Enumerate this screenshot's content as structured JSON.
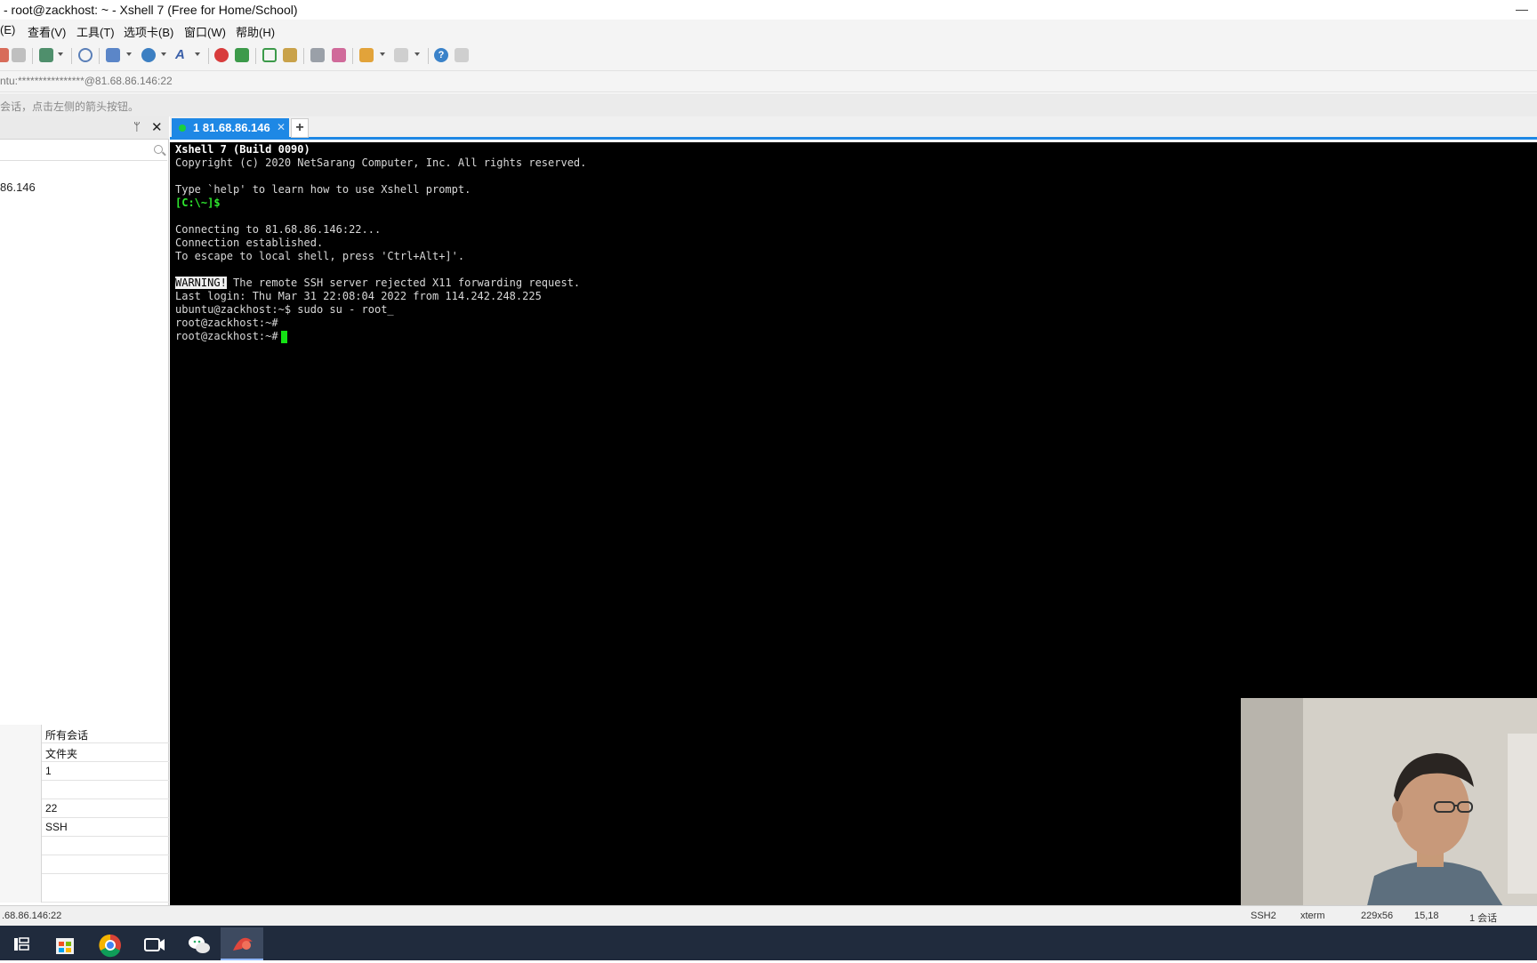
{
  "window": {
    "title": "- root@zackhost: ~ - Xshell 7 (Free for Home/School)",
    "minimize": "—"
  },
  "menu": [
    "(E)",
    "查看(V)",
    "工具(T)",
    "选项卡(B)",
    "窗口(W)",
    "帮助(H)"
  ],
  "address_bar": {
    "text": "ntu:****************@81.68.86.146:22"
  },
  "hint_bar": {
    "text": "会话，点击左侧的箭头按钮。"
  },
  "sidebar": {
    "pin": "ᛘ",
    "close": "✕",
    "session": "86.146",
    "properties": [
      "所有会话",
      "文件夹",
      "1",
      "",
      "22",
      "SSH",
      "",
      "",
      ""
    ]
  },
  "tabs": [
    {
      "label": "1 81.68.86.146",
      "status_color": "#1bcf3c"
    }
  ],
  "tab_add": "+",
  "terminal": {
    "line1": "Xshell 7 (Build 0090)",
    "line2": "Copyright (c) 2020 NetSarang Computer, Inc. All rights reserved.",
    "line3": "Type `help' to learn how to use Xshell prompt.",
    "line4": "[C:\\~]$",
    "line5": "Connecting to 81.68.86.146:22...",
    "line6": "Connection established.",
    "line7": "To escape to local shell, press 'Ctrl+Alt+]'.",
    "warning_label": "WARNING!",
    "line8_rest": " The remote SSH server rejected X11 forwarding request.",
    "line9": "Last login: Thu Mar 31 22:08:04 2022 from 114.242.248.225",
    "line10": "ubuntu@zackhost:~$ sudo su - root_",
    "line11": "root@zackhost:~#",
    "line12": "root@zackhost:~#"
  },
  "status_bar": {
    "left": ".68.86.146:22",
    "protocol": "SSH2",
    "term_type": "xterm",
    "size": "229x56",
    "cursor_pos": "15,18",
    "sessions": "1 会话"
  },
  "colors": {
    "accent": "#1e88e5",
    "terminal_bg": "#000000",
    "prompt_green": "#2ee82e",
    "taskbar": "#202b3d"
  },
  "taskbar_icons": [
    "task-view-icon",
    "store-icon",
    "chrome-icon",
    "video-call-icon",
    "wechat-icon",
    "xshell-icon"
  ]
}
